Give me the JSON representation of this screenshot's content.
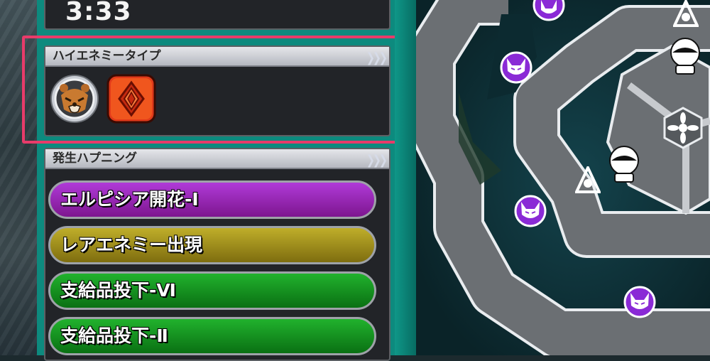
{
  "timer": {
    "value": "3:33"
  },
  "high_enemy": {
    "title": "ハイエネミータイプ",
    "types": [
      {
        "name": "beast-type",
        "icon": "bear-face-icon"
      },
      {
        "name": "crystal-type",
        "icon": "red-diamond-icon"
      }
    ]
  },
  "happenings": {
    "title": "発生ハプニング",
    "items": [
      {
        "label": "エルピシア開花-Ⅰ",
        "color": "#b03ad8"
      },
      {
        "label": "レアエネミー出現",
        "color": "#bfae2a"
      },
      {
        "label": "支給品投下-Ⅵ",
        "color": "#21b22d"
      },
      {
        "label": "支給品投下-Ⅱ",
        "color": "#21b22d"
      }
    ]
  },
  "map": {
    "markers": [
      {
        "type": "demon-face-icon",
        "count": 4
      },
      {
        "type": "crystal-ball-icon",
        "count": 2
      },
      {
        "type": "triangle-emblem-icon",
        "count": 2
      },
      {
        "type": "flower-emblem-icon",
        "count": 1
      }
    ]
  },
  "colors": {
    "accent_highlight": "#e83b6a",
    "panel_teal": "#0d8a7e",
    "demon_marker": "#8a2ad6"
  }
}
